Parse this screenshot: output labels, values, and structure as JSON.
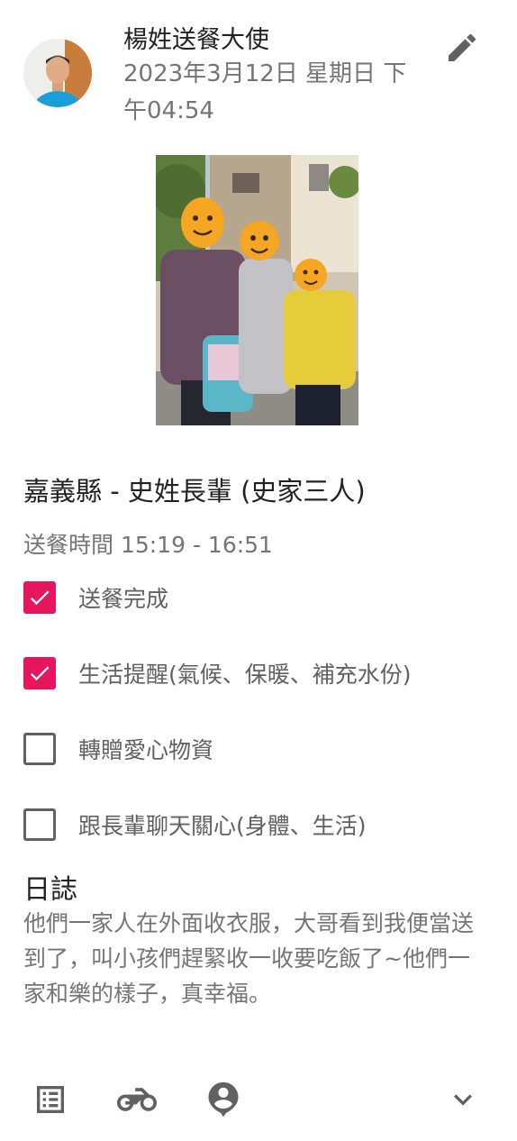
{
  "post": {
    "author": "楊姓送餐大使",
    "datetime": "2023年3月12日 星期日 下午04:54",
    "title": "嘉義縣 - 史姓長輩 (史家三人)",
    "delivery_time": "送餐時間 15:19 - 16:51"
  },
  "checklist": [
    {
      "label": "送餐完成",
      "checked": true
    },
    {
      "label": "生活提醒(氣候、保暖、補充水份)",
      "checked": true
    },
    {
      "label": "轉贈愛心物資",
      "checked": false
    },
    {
      "label": "跟長輩聊天關心(身體、生活)",
      "checked": false
    }
  ],
  "journal": {
    "heading": "日誌",
    "text": "他們一家人在外面收衣服，大哥看到我便當送到了，叫小孩們趕緊收一收要吃飯了~他們一家和樂的樣子，真幸福。"
  },
  "toolbar": {
    "icons": [
      "list-icon",
      "motorcycle-icon",
      "location-person-icon",
      "chevron-down-icon"
    ]
  },
  "colors": {
    "accent": "#e8175d",
    "icon_gray": "#616161",
    "secondary_text": "#757575"
  }
}
